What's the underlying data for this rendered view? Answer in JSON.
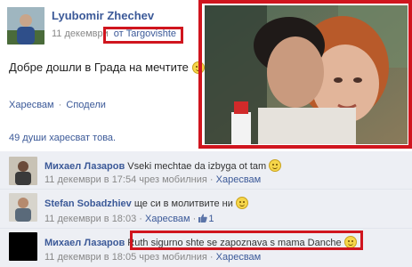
{
  "post": {
    "author": "Lyubomir Zhechev",
    "date": "11 декември",
    "location": "от Targovishte",
    "text": "Добре дошли в Града на мечтите"
  },
  "actions": {
    "like": "Харесвам",
    "dot": "·",
    "share": "Сподели"
  },
  "likes_summary": "49 души харесват това.",
  "comments": [
    {
      "author": "Михаел Лазаров",
      "text": "Vseki mechtae da izbyga ot tam",
      "date": "11 декември в 17:54",
      "via": "чрез мобилния",
      "like": "Харесвам"
    },
    {
      "author": "Stefan Sobadzhiev",
      "text": "ще си в молитвите ни",
      "date": "11 декември в 18:03",
      "like": "Харесвам",
      "like_count": "1"
    },
    {
      "author": "Михаел Лазаров",
      "text": "Ruth sigurno shte se zapoznava s mama Danche",
      "date": "11 декември в 18:05",
      "via": "чрез мобилния",
      "like": "Харесвам"
    }
  ],
  "colors": {
    "link": "#3b5998",
    "highlight": "#d0151e",
    "comment_bg": "#edeff4"
  },
  "icons": [
    "avatar",
    "photo",
    "smiley-icon",
    "thumb-up-icon"
  ]
}
